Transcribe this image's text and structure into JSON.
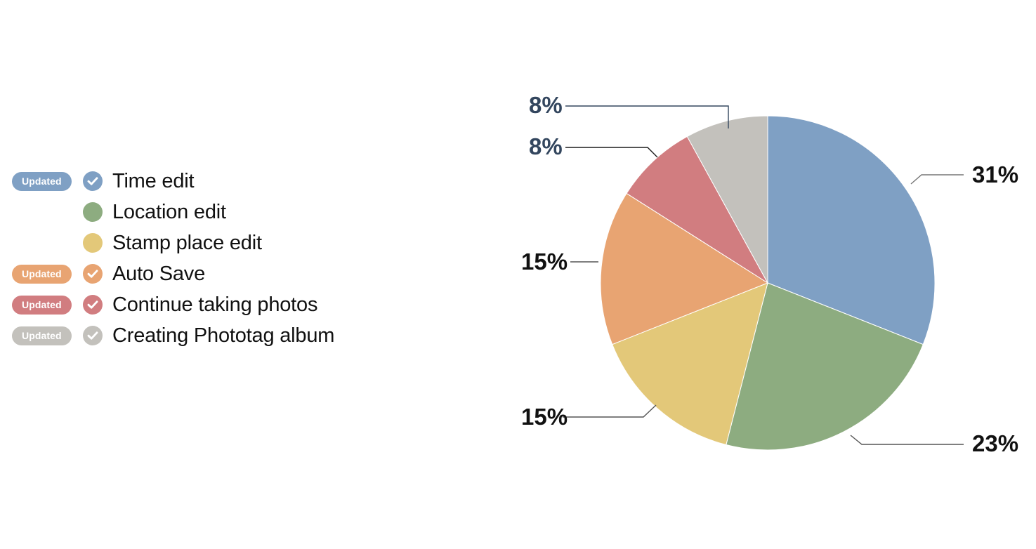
{
  "legend": {
    "badge_text": "Updated",
    "items": [
      {
        "label": "Time edit",
        "color": "#7fa0c4",
        "badge": true,
        "check": true
      },
      {
        "label": "Location edit",
        "color": "#8dac80",
        "badge": false,
        "check": false
      },
      {
        "label": "Stamp place edit",
        "color": "#e3c879",
        "badge": false,
        "check": false
      },
      {
        "label": "Auto Save",
        "color": "#e8a472",
        "badge": true,
        "check": true
      },
      {
        "label": "Continue taking photos",
        "color": "#d17d80",
        "badge": true,
        "check": true
      },
      {
        "label": "Creating Phototag album",
        "color": "#c3c1bc",
        "badge": true,
        "check": true
      }
    ]
  },
  "chart_data": {
    "type": "pie",
    "title": "",
    "start_angle_deg": 0,
    "direction": "clockwise",
    "legend_position": "left",
    "categories": [
      "Time edit",
      "Location edit",
      "Stamp place edit",
      "Auto Save",
      "Continue taking photos",
      "Creating Phototag album"
    ],
    "values": [
      31,
      23,
      15,
      15,
      8,
      8
    ],
    "value_unit": "%",
    "labels": [
      "31%",
      "23%",
      "15%",
      "15%",
      "8%",
      "8%"
    ],
    "colors": [
      "#7fa0c4",
      "#8dac80",
      "#e3c879",
      "#e8a472",
      "#d17d80",
      "#c3c1bc"
    ],
    "label_colors": [
      "#111111",
      "#111111",
      "#111111",
      "#111111",
      "#33465e",
      "#33465e"
    ],
    "slices": [
      {
        "name": "Time edit",
        "value": 31,
        "label": "31%",
        "color": "#7fa0c4"
      },
      {
        "name": "Location edit",
        "value": 23,
        "label": "23%",
        "color": "#8dac80"
      },
      {
        "name": "Stamp place edit",
        "value": 15,
        "label": "15%",
        "color": "#e3c879"
      },
      {
        "name": "Auto Save",
        "value": 15,
        "label": "15%",
        "color": "#e8a472"
      },
      {
        "name": "Continue taking photos",
        "value": 8,
        "label": "8%",
        "color": "#d17d80"
      },
      {
        "name": "Creating Phototag album",
        "value": 8,
        "label": "8%",
        "color": "#c3c1bc"
      }
    ]
  },
  "pct_labels": {
    "blue": "31%",
    "green": "23%",
    "yellow": "15%",
    "orange": "15%",
    "red": "8%",
    "gray": "8%"
  }
}
